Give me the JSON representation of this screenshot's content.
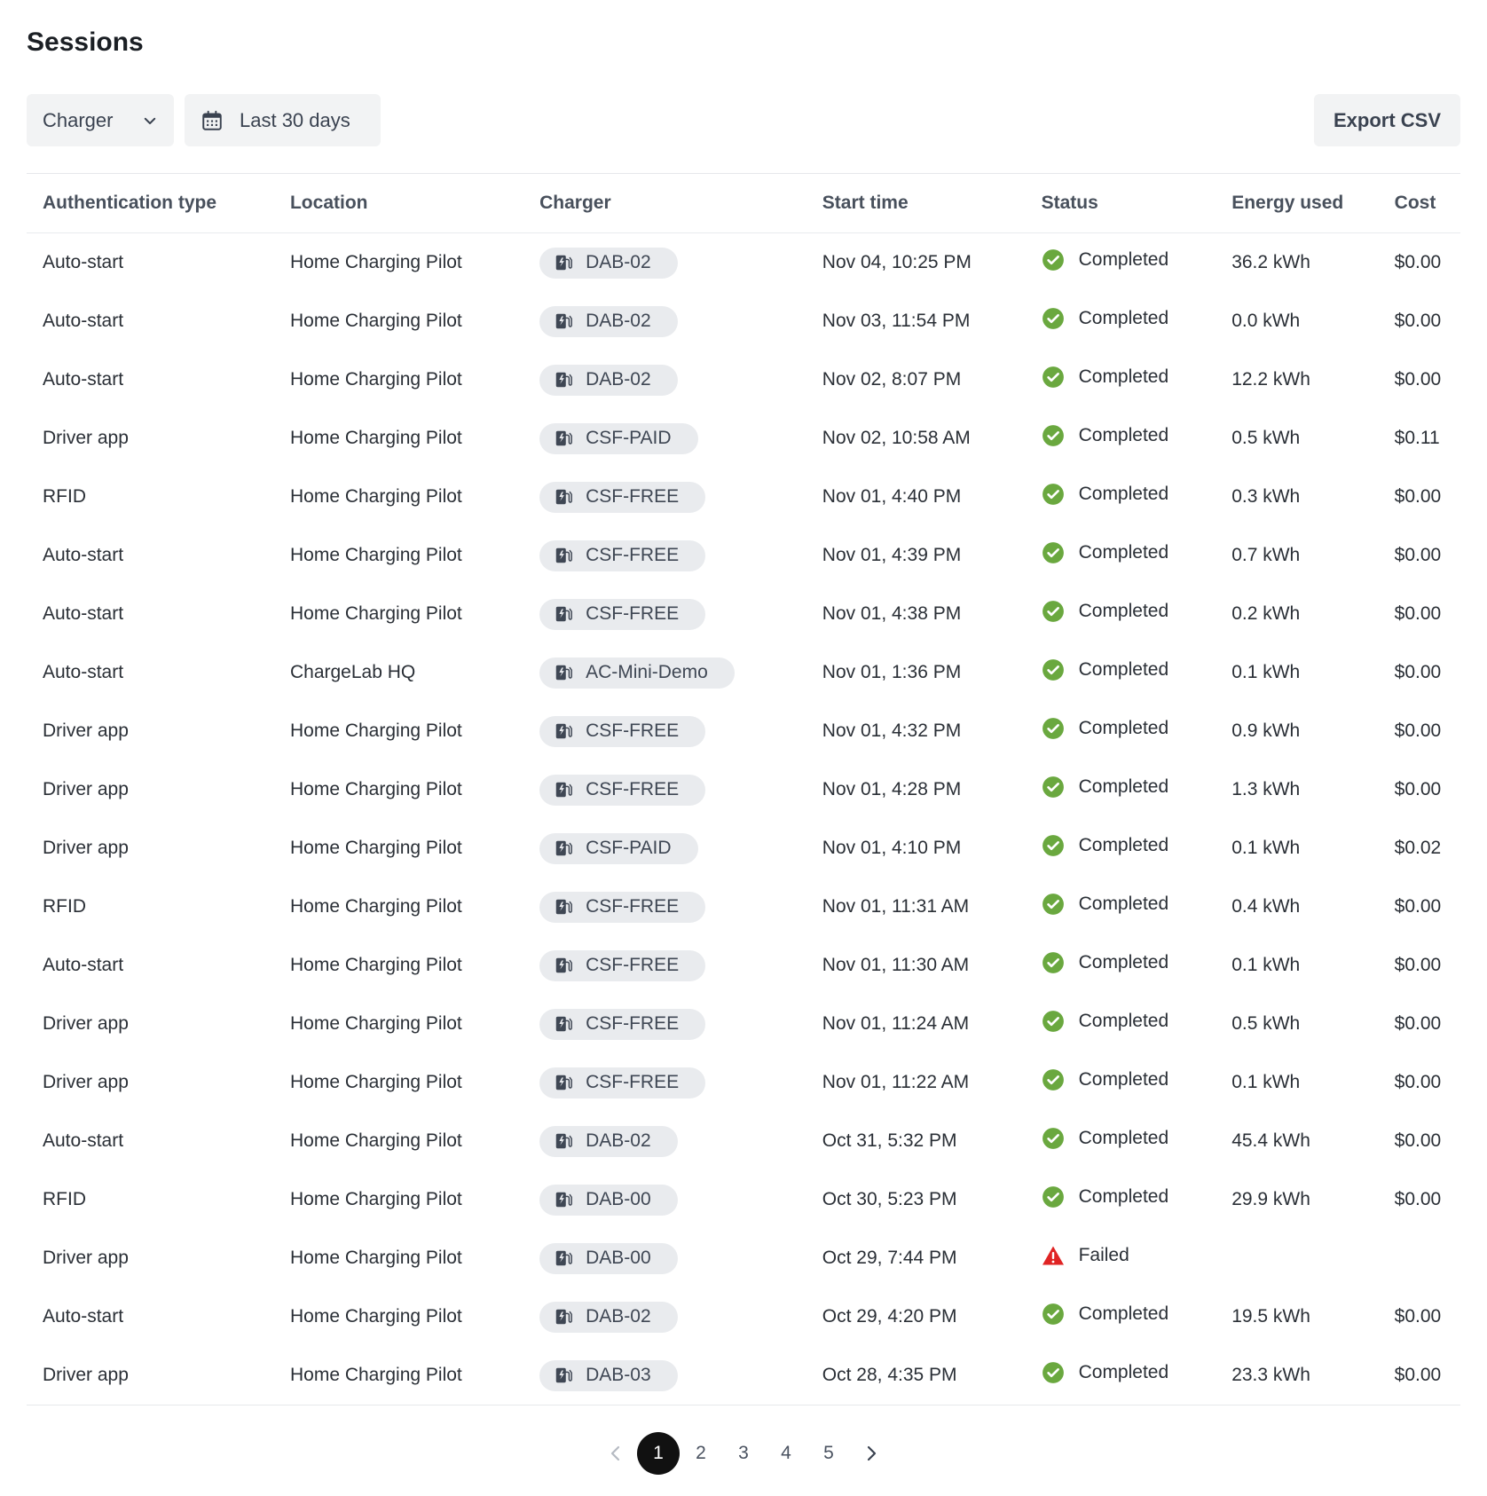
{
  "page": {
    "title": "Sessions"
  },
  "toolbar": {
    "charger_filter": "Charger",
    "date_filter": "Last 30 days",
    "export_label": "Export CSV"
  },
  "table": {
    "headers": [
      "Authentication type",
      "Location",
      "Charger",
      "Start time",
      "Status",
      "Energy used",
      "Cost"
    ],
    "rows": [
      {
        "auth": "Auto-start",
        "location": "Home Charging Pilot",
        "charger": "DAB-02",
        "start": "Nov 04, 10:25 PM",
        "status": "Completed",
        "energy": "36.2 kWh",
        "cost": "$0.00"
      },
      {
        "auth": "Auto-start",
        "location": "Home Charging Pilot",
        "charger": "DAB-02",
        "start": "Nov 03, 11:54 PM",
        "status": "Completed",
        "energy": "0.0 kWh",
        "cost": "$0.00"
      },
      {
        "auth": "Auto-start",
        "location": "Home Charging Pilot",
        "charger": "DAB-02",
        "start": "Nov 02, 8:07 PM",
        "status": "Completed",
        "energy": "12.2 kWh",
        "cost": "$0.00"
      },
      {
        "auth": "Driver app",
        "location": "Home Charging Pilot",
        "charger": "CSF-PAID",
        "start": "Nov 02, 10:58 AM",
        "status": "Completed",
        "energy": "0.5 kWh",
        "cost": "$0.11"
      },
      {
        "auth": "RFID",
        "location": "Home Charging Pilot",
        "charger": "CSF-FREE",
        "start": "Nov 01, 4:40 PM",
        "status": "Completed",
        "energy": "0.3 kWh",
        "cost": "$0.00"
      },
      {
        "auth": "Auto-start",
        "location": "Home Charging Pilot",
        "charger": "CSF-FREE",
        "start": "Nov 01, 4:39 PM",
        "status": "Completed",
        "energy": "0.7 kWh",
        "cost": "$0.00"
      },
      {
        "auth": "Auto-start",
        "location": "Home Charging Pilot",
        "charger": "CSF-FREE",
        "start": "Nov 01, 4:38 PM",
        "status": "Completed",
        "energy": "0.2 kWh",
        "cost": "$0.00"
      },
      {
        "auth": "Auto-start",
        "location": "ChargeLab HQ",
        "charger": "AC-Mini-Demo",
        "start": "Nov 01, 1:36 PM",
        "status": "Completed",
        "energy": "0.1 kWh",
        "cost": "$0.00"
      },
      {
        "auth": "Driver app",
        "location": "Home Charging Pilot",
        "charger": "CSF-FREE",
        "start": "Nov 01, 4:32 PM",
        "status": "Completed",
        "energy": "0.9 kWh",
        "cost": "$0.00"
      },
      {
        "auth": "Driver app",
        "location": "Home Charging Pilot",
        "charger": "CSF-FREE",
        "start": "Nov 01, 4:28 PM",
        "status": "Completed",
        "energy": "1.3 kWh",
        "cost": "$0.00"
      },
      {
        "auth": "Driver app",
        "location": "Home Charging Pilot",
        "charger": "CSF-PAID",
        "start": "Nov 01, 4:10 PM",
        "status": "Completed",
        "energy": "0.1 kWh",
        "cost": "$0.02"
      },
      {
        "auth": "RFID",
        "location": "Home Charging Pilot",
        "charger": "CSF-FREE",
        "start": "Nov 01, 11:31 AM",
        "status": "Completed",
        "energy": "0.4 kWh",
        "cost": "$0.00"
      },
      {
        "auth": "Auto-start",
        "location": "Home Charging Pilot",
        "charger": "CSF-FREE",
        "start": "Nov 01, 11:30 AM",
        "status": "Completed",
        "energy": "0.1 kWh",
        "cost": "$0.00"
      },
      {
        "auth": "Driver app",
        "location": "Home Charging Pilot",
        "charger": "CSF-FREE",
        "start": "Nov 01, 11:24 AM",
        "status": "Completed",
        "energy": "0.5 kWh",
        "cost": "$0.00"
      },
      {
        "auth": "Driver app",
        "location": "Home Charging Pilot",
        "charger": "CSF-FREE",
        "start": "Nov 01, 11:22 AM",
        "status": "Completed",
        "energy": "0.1 kWh",
        "cost": "$0.00"
      },
      {
        "auth": "Auto-start",
        "location": "Home Charging Pilot",
        "charger": "DAB-02",
        "start": "Oct 31, 5:32 PM",
        "status": "Completed",
        "energy": "45.4 kWh",
        "cost": "$0.00"
      },
      {
        "auth": "RFID",
        "location": "Home Charging Pilot",
        "charger": "DAB-00",
        "start": "Oct 30, 5:23 PM",
        "status": "Completed",
        "energy": "29.9 kWh",
        "cost": "$0.00"
      },
      {
        "auth": "Driver app",
        "location": "Home Charging Pilot",
        "charger": "DAB-00",
        "start": "Oct 29, 7:44 PM",
        "status": "Failed",
        "energy": "",
        "cost": ""
      },
      {
        "auth": "Auto-start",
        "location": "Home Charging Pilot",
        "charger": "DAB-02",
        "start": "Oct 29, 4:20 PM",
        "status": "Completed",
        "energy": "19.5 kWh",
        "cost": "$0.00"
      },
      {
        "auth": "Driver app",
        "location": "Home Charging Pilot",
        "charger": "DAB-03",
        "start": "Oct 28, 4:35 PM",
        "status": "Completed",
        "energy": "23.3 kWh",
        "cost": "$0.00"
      }
    ]
  },
  "pagination": {
    "pages": [
      "1",
      "2",
      "3",
      "4",
      "5"
    ],
    "current": "1"
  },
  "icons": {
    "charger_filter_chevron": "chevron-down-icon",
    "date_filter_icon": "calendar-icon",
    "charger_pill_icon": "ev-charger-icon",
    "completed_icon": "check-circle-icon",
    "failed_icon": "warning-triangle-icon",
    "prev_icon": "chevron-left-icon",
    "next_icon": "chevron-right-icon"
  },
  "colors": {
    "completed": "#6aa83f",
    "failed": "#e02424",
    "active_page_bg": "#111111"
  }
}
